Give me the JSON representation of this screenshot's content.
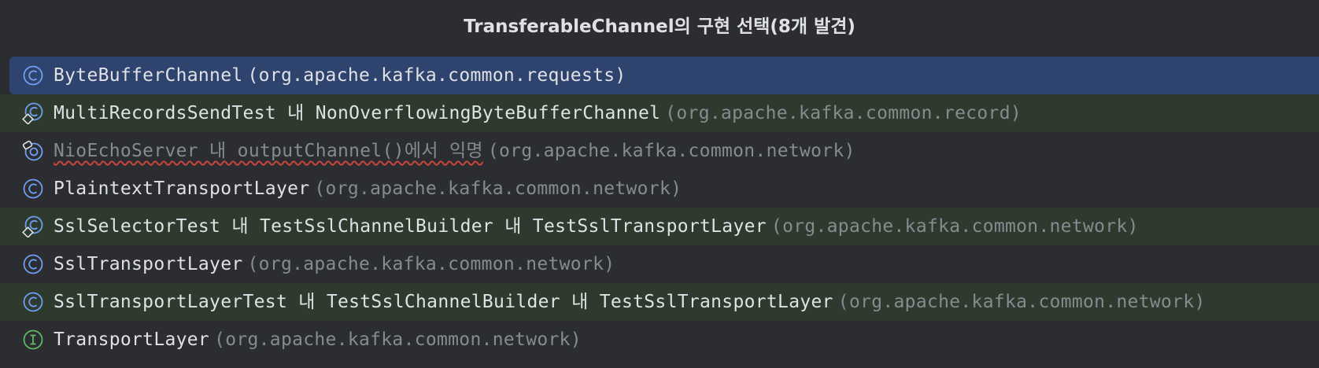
{
  "popup": {
    "title": "TransferableChannel의 구현 선택(8개 발견)"
  },
  "items": [
    {
      "name": "ByteBufferChannel",
      "package": "org.apache.kafka.common.requests",
      "icon": "class-icon",
      "selected": true,
      "test": false
    },
    {
      "name": "MultiRecordsSendTest 내 NonOverflowingByteBufferChannel",
      "package": "org.apache.kafka.common.record",
      "icon": "test-class-icon",
      "selected": false,
      "test": true
    },
    {
      "name": "NioEchoServer 내 outputChannel()에서 익명",
      "package": "org.apache.kafka.common.network",
      "icon": "anonymous-class-icon",
      "selected": false,
      "test": false
    },
    {
      "name": "PlaintextTransportLayer",
      "package": "org.apache.kafka.common.network",
      "icon": "class-icon",
      "selected": false,
      "test": false
    },
    {
      "name": "SslSelectorTest 내 TestSslChannelBuilder 내 TestSslTransportLayer",
      "package": "org.apache.kafka.common.network",
      "icon": "test-class-icon",
      "selected": false,
      "test": true
    },
    {
      "name": "SslTransportLayer",
      "package": "org.apache.kafka.common.network",
      "icon": "class-icon",
      "selected": false,
      "test": false
    },
    {
      "name": "SslTransportLayerTest 내 TestSslChannelBuilder 내 TestSslTransportLayer",
      "package": "org.apache.kafka.common.network",
      "icon": "class-icon",
      "selected": false,
      "test": true
    },
    {
      "name": "TransportLayer",
      "package": "org.apache.kafka.common.network",
      "icon": "interface-icon",
      "selected": false,
      "test": false
    }
  ],
  "colors": {
    "background": "#2b2d30",
    "selected": "#2e436e",
    "test_row": "#2e3a2d",
    "class_icon": "#6f9ef2",
    "interface_icon": "#5fb865",
    "error_underline": "#c9453d"
  }
}
